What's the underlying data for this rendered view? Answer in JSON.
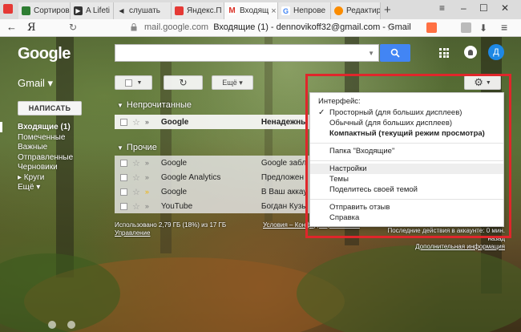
{
  "browser": {
    "tabs": [
      {
        "label": "Сортиров",
        "fav_color": "#2e7d32"
      },
      {
        "label": "A Lifeti",
        "fav_color": "#333333"
      },
      {
        "label": "слушать",
        "fav_color": "#1a73e8"
      },
      {
        "label": "Яндекс.П",
        "fav_color": "#e53935"
      },
      {
        "label": "Входящ",
        "fav_color": "#d93025"
      },
      {
        "label": "Непрове",
        "fav_color": "#4285f4"
      },
      {
        "label": "Редактир",
        "fav_color": "#fb8c00"
      }
    ],
    "active_tab_index": 4,
    "yandex_logo": "Я",
    "url_host": "mail.google.com",
    "url_title": "Входящие (1) - dennovikoff32@gmail.com - Gmail"
  },
  "gmail": {
    "logo": "Google",
    "label": "Gmail ▾",
    "search": {
      "placeholder": "",
      "value": ""
    },
    "avatar_letter": "Д",
    "compose": "НАПИСАТЬ",
    "nav": [
      {
        "label": "Входящие (1)",
        "bold": true
      },
      {
        "label": "Помеченные"
      },
      {
        "label": "Важные"
      },
      {
        "label": "Отправленные"
      },
      {
        "label": "Черновики"
      },
      {
        "label": "▸ Круги"
      },
      {
        "label": "Ещё ▾"
      }
    ],
    "toolbar": {
      "more_label": "Ещё ▾"
    },
    "sections": {
      "unread": "Непрочитанные",
      "other": "Прочие"
    },
    "unread_rows": [
      {
        "from": "Google",
        "subject": "Ненадежны",
        "important": false
      }
    ],
    "other_rows": [
      {
        "from": "Google",
        "subject": "Google забл",
        "important": false
      },
      {
        "from": "Google Analytics",
        "subject": "Предложен",
        "important": false
      },
      {
        "from": "Google",
        "subject": "В Ваш аккау",
        "important": true
      },
      {
        "from": "YouTube",
        "subject": "Богдан Кузь",
        "important": false
      }
    ],
    "footer": {
      "usage": "Использовано 2,79 ГБ (18%) из 17 ГБ",
      "manage": "Управление",
      "terms": "Условия – Конфиденциальность",
      "activity": "Последние действия в аккаунте: 0 мин. назад",
      "details": "Дополнительная информация"
    },
    "settings_menu": {
      "header": "Интерфейс:",
      "density": [
        {
          "label": "Просторный (для больших дисплеев)",
          "checked": true
        },
        {
          "label": "Обычный (для больших дисплеев)"
        },
        {
          "label": "Компактный (текущий режим просмотра)",
          "bold": true
        }
      ],
      "inbox_folder": "Папка \"Входящие\"",
      "settings": "Настройки",
      "themes": "Темы",
      "share_theme": "Поделитесь своей темой",
      "feedback": "Отправить отзыв",
      "help": "Справка"
    }
  }
}
